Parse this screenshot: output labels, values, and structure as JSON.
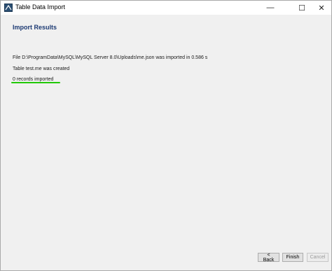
{
  "window": {
    "title": "Table Data Import",
    "controls": {
      "minimize": "—",
      "maximize": "☐",
      "close": "✕"
    }
  },
  "page": {
    "heading": "Import Results",
    "messages": [
      "File D:\\ProgramData\\MySQL\\MySQL Server 8.0\\Uploads\\me.json was imported in 0.586 s",
      "Table test.me was created",
      "0 records imported"
    ],
    "highlight_color": "#22c900"
  },
  "footer": {
    "back_label": "< Back",
    "finish_label": "Finish",
    "cancel_label": "Cancel"
  },
  "icons": {
    "app": "mysql-workbench-icon"
  }
}
